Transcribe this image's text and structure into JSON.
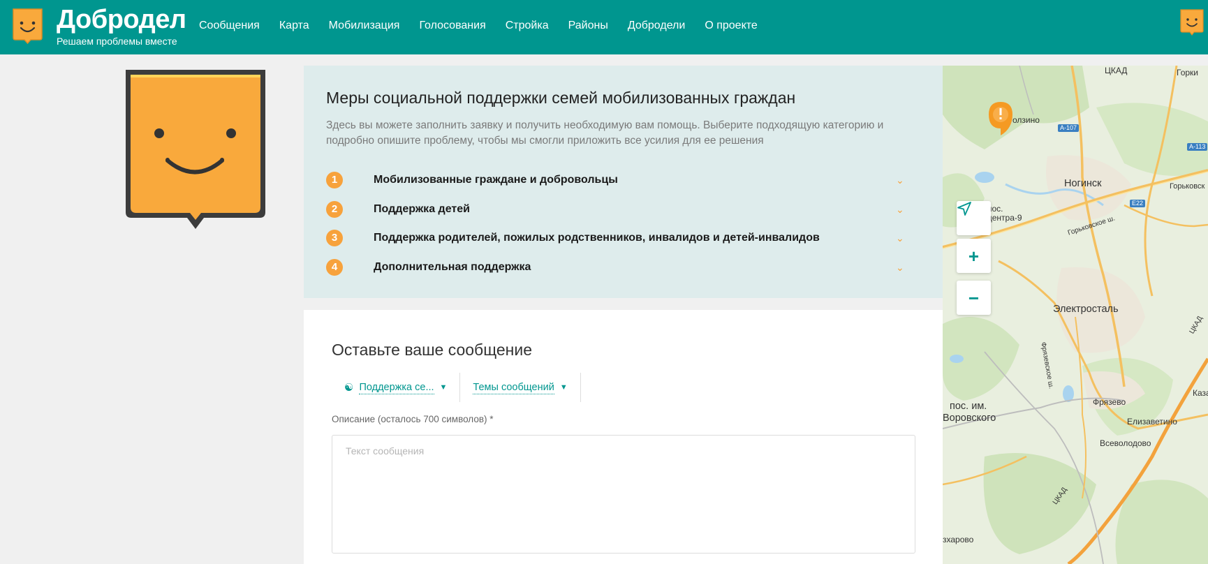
{
  "header": {
    "brand_title": "Добродел",
    "brand_subtitle": "Решаем проблемы вместе",
    "nav": [
      "Сообщения",
      "Карта",
      "Мобилизация",
      "Голосования",
      "Стройка",
      "Районы",
      "Добродели",
      "О проекте"
    ],
    "logo_icon": "smiley-shield-icon",
    "avatar_icon": "smiley-shield-icon"
  },
  "colors": {
    "brand": "#00968f",
    "accent": "#f7a23c",
    "panel": "#deecec"
  },
  "info": {
    "title": "Меры социальной поддержки семей мобилизованных граждан",
    "description": "Здесь вы можете заполнить заявку и получить необходимую вам помощь. Выберите подходящую категорию и подробно опишите проблему, чтобы мы смогли приложить все усилия для ее решения",
    "categories": [
      {
        "num": "1",
        "label": "Мобилизованные граждане и добровольцы"
      },
      {
        "num": "2",
        "label": "Поддержка детей"
      },
      {
        "num": "3",
        "label": "Поддержка родителей, пожилых родственников, инвалидов и детей-инвалидов"
      },
      {
        "num": "4",
        "label": "Дополнительная поддержка"
      }
    ]
  },
  "message": {
    "title": "Оставьте ваше сообщение",
    "category_select": "Поддержка се...",
    "topic_select": "Темы сообщений",
    "description_label": "Описание (осталось 700 символов) *",
    "textarea_placeholder": "Текст сообщения"
  },
  "map": {
    "zoom_in": "+",
    "zoom_out": "−",
    "labels": {
      "gorki": "Горки",
      "ozino": "олзино",
      "a107": "А-107",
      "a113": "А-113",
      "noginsk": "Ногинск",
      "gorkovskoe": "Горьковск",
      "pos": "пос.",
      "centra9": "центра-9",
      "e22": "E22",
      "gorkovskoe_sh": "Горьковское ш.",
      "elektrostal": "Электросталь",
      "fryazevskoe": "Фрязевское ш.",
      "ckad1": "ЦКАД",
      "kaza": "Каза",
      "fryazevo": "Фрязево",
      "pos_im": "пос. им.",
      "vorovskogo": "Воровского",
      "elizavetino": "Елизаветино",
      "vsevolodovo": "Всеволодово",
      "ckad2": "ЦКАД",
      "zaharovo": "зхарово",
      "ckad_top": "ЦКАД"
    }
  }
}
